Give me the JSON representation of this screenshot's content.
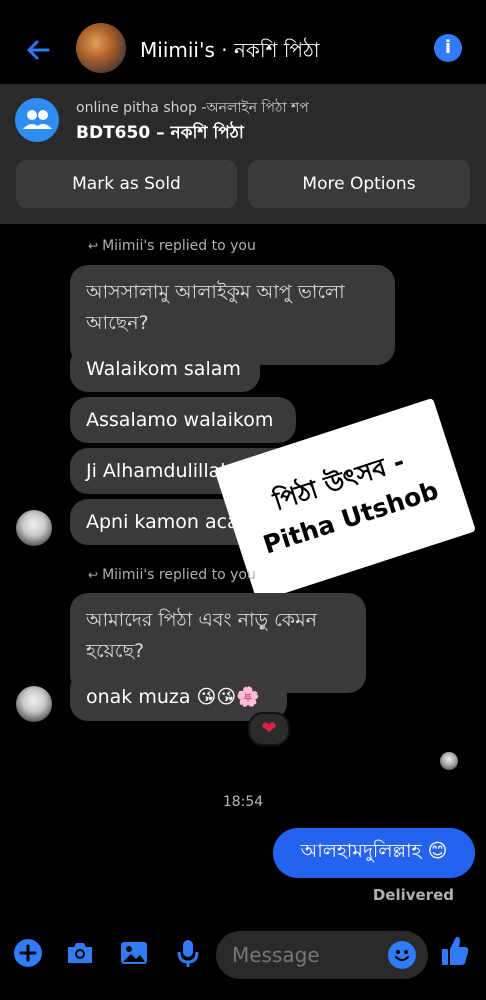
{
  "status_bar": {
    "time": "",
    "signal": "",
    "battery": ""
  },
  "header": {
    "title": "Miimii's · নকশি পিঠা",
    "info_label": "i"
  },
  "listing": {
    "shop_name": "online pitha shop -অনলাইন পিঠা শপ",
    "price_title": "BDT650 – নকশি পিঠা",
    "mark_sold_label": "Mark as Sold",
    "more_options_label": "More Options"
  },
  "messages": {
    "reply_note_1": "Miimii's replied to you",
    "quoted_1": "আসসালামু আলাইকুম আপু ভালো আছেন?",
    "msg_1": "Walaikom salam",
    "msg_2": "Assalamo walaikom",
    "msg_3": "Ji Alhamdulillah valu",
    "msg_4": "Apni kamon aca",
    "reply_note_2": "Miimii's replied to you",
    "quoted_2": "আমাদের পিঠা এবং নাড়ু কেমন হয়েছে?",
    "msg_5": "onak muza 😘😘🌸",
    "reaction": "❤",
    "timestamp": "18:54",
    "outgoing": "আলহামদুলিল্লাহ 😊",
    "delivered": "Delivered"
  },
  "sticker": {
    "line1": "পিঠা উৎসব -",
    "line2": "Pitha Utshob"
  },
  "composer": {
    "placeholder": "Message"
  },
  "colors": {
    "accent": "#2f7cf6",
    "bubble_incoming": "#3a3a3c",
    "bubble_outgoing": "#2462f0",
    "banner": "#2a2a2c"
  },
  "icons": [
    "back-arrow-icon",
    "info-icon",
    "group-icon",
    "plus-icon",
    "camera-icon",
    "image-icon",
    "microphone-icon",
    "emoji-icon",
    "thumbs-up-icon",
    "reply-arrow-icon"
  ]
}
